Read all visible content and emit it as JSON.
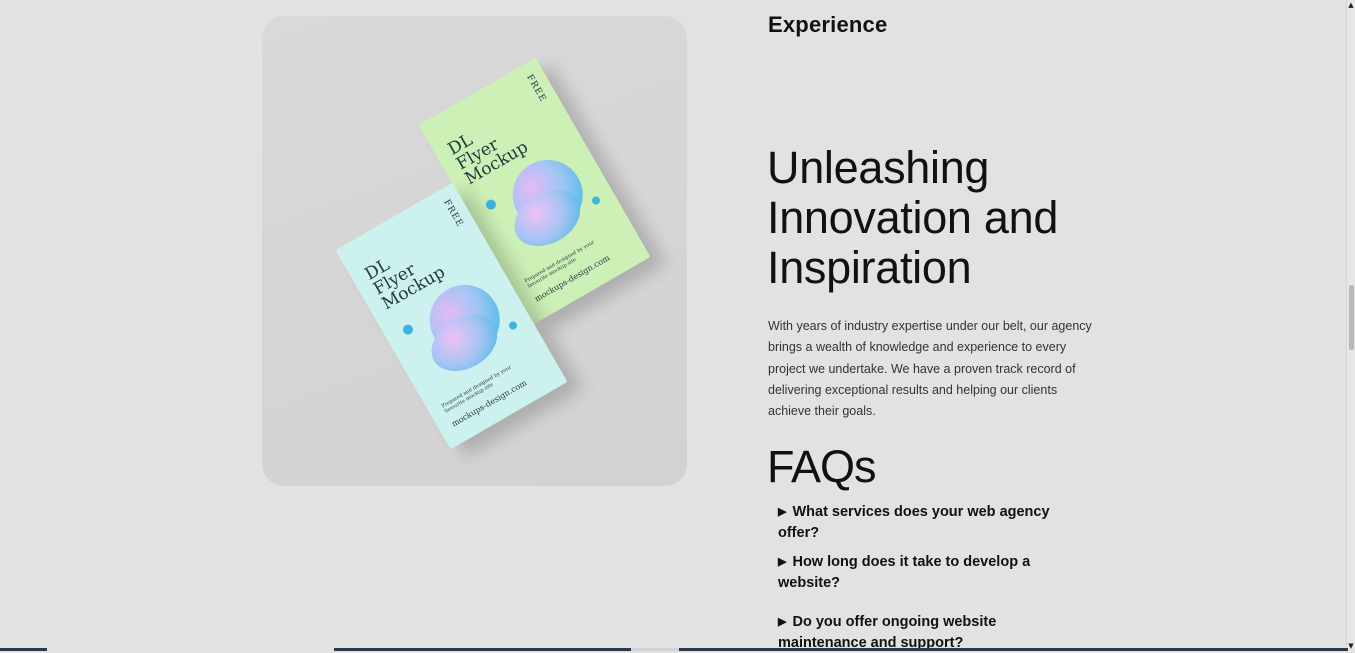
{
  "media": {
    "flyers": [
      {
        "title_lines": [
          "DL",
          "Flyer",
          "Mockup"
        ],
        "badge": "FREE",
        "small_text": "Prepared and designed by your favourite mockup site",
        "url": "mockups-design.com"
      },
      {
        "title_lines": [
          "DL",
          "Flyer",
          "Mockup"
        ],
        "badge": "FREE",
        "small_text": "Prepared and designed by your favourite mockup site",
        "url": "mockups-design.com"
      }
    ]
  },
  "section": {
    "label": "Experience",
    "headline": "Unleashing Innovation and Inspiration",
    "paragraph": "With years of industry expertise under our belt, our agency brings a wealth of knowledge and experience to every project we undertake. We have a proven track record of delivering exceptional results and helping our clients achieve their goals."
  },
  "faq": {
    "title": "FAQs",
    "items": [
      {
        "question": "What services does your web agency offer?"
      },
      {
        "question": "How long does it take to develop a website?"
      },
      {
        "question": "Do you offer ongoing website maintenance and support?"
      }
    ]
  },
  "scrollbar": {
    "up_glyph": "▲",
    "down_glyph": "▼"
  },
  "colors": {
    "background": "#e2e2e2",
    "card": "#d4d4d4",
    "flyer_green": "#cdf0b6",
    "flyer_cyan": "#cdf1ee",
    "blob_blue": "#33b8e0",
    "text": "#111111"
  }
}
